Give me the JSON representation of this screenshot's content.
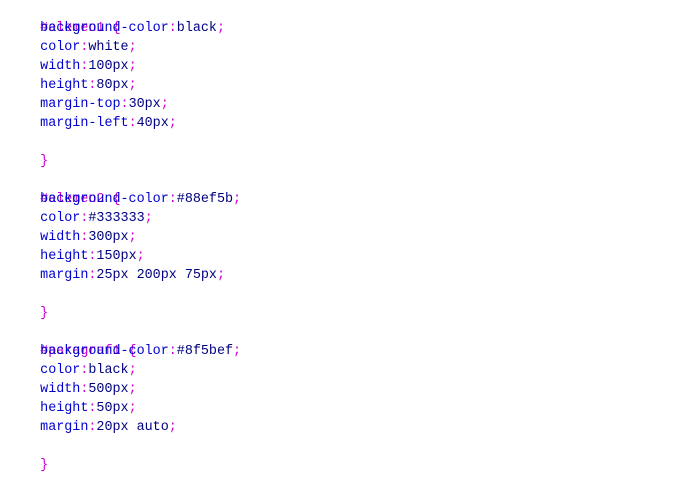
{
  "editor": {
    "lines": [
      {
        "type": "selector",
        "text": "#elemen1 {"
      },
      {
        "type": "decl",
        "prop": "background-color",
        "value": "black"
      },
      {
        "type": "decl",
        "prop": "color",
        "value": "white"
      },
      {
        "type": "decl",
        "prop": "width",
        "value": "100px"
      },
      {
        "type": "decl",
        "prop": "height",
        "value": "80px"
      },
      {
        "type": "decl",
        "prop": "margin-top",
        "value": "30px"
      },
      {
        "type": "decl",
        "prop": "margin-left",
        "value": "40px"
      },
      {
        "type": "close",
        "text": "}"
      },
      {
        "type": "blank"
      },
      {
        "type": "selector",
        "text": "#elemen2 {"
      },
      {
        "type": "decl",
        "prop": "background-color",
        "value": "#88ef5b"
      },
      {
        "type": "decl",
        "prop": "color",
        "value": "#333333"
      },
      {
        "type": "decl",
        "prop": "width",
        "value": "300px"
      },
      {
        "type": "decl",
        "prop": "height",
        "value": "150px"
      },
      {
        "type": "decl",
        "prop": "margin",
        "value": "25px 200px 75px"
      },
      {
        "type": "close",
        "text": "}"
      },
      {
        "type": "blank"
      },
      {
        "type": "selector",
        "text": "#paragraf1 {"
      },
      {
        "type": "decl",
        "prop": "background-color",
        "value": "#8f5bef"
      },
      {
        "type": "decl",
        "prop": "color",
        "value": "black"
      },
      {
        "type": "decl",
        "prop": "width",
        "value": "500px"
      },
      {
        "type": "decl",
        "prop": "height",
        "value": "50px"
      },
      {
        "type": "decl",
        "prop": "margin",
        "value": "20px auto"
      },
      {
        "type": "close",
        "text": "}"
      }
    ]
  },
  "colors": {
    "selector": "#d000d0",
    "property": "#0000d0",
    "value": "#000080",
    "background": "#ffffff"
  }
}
